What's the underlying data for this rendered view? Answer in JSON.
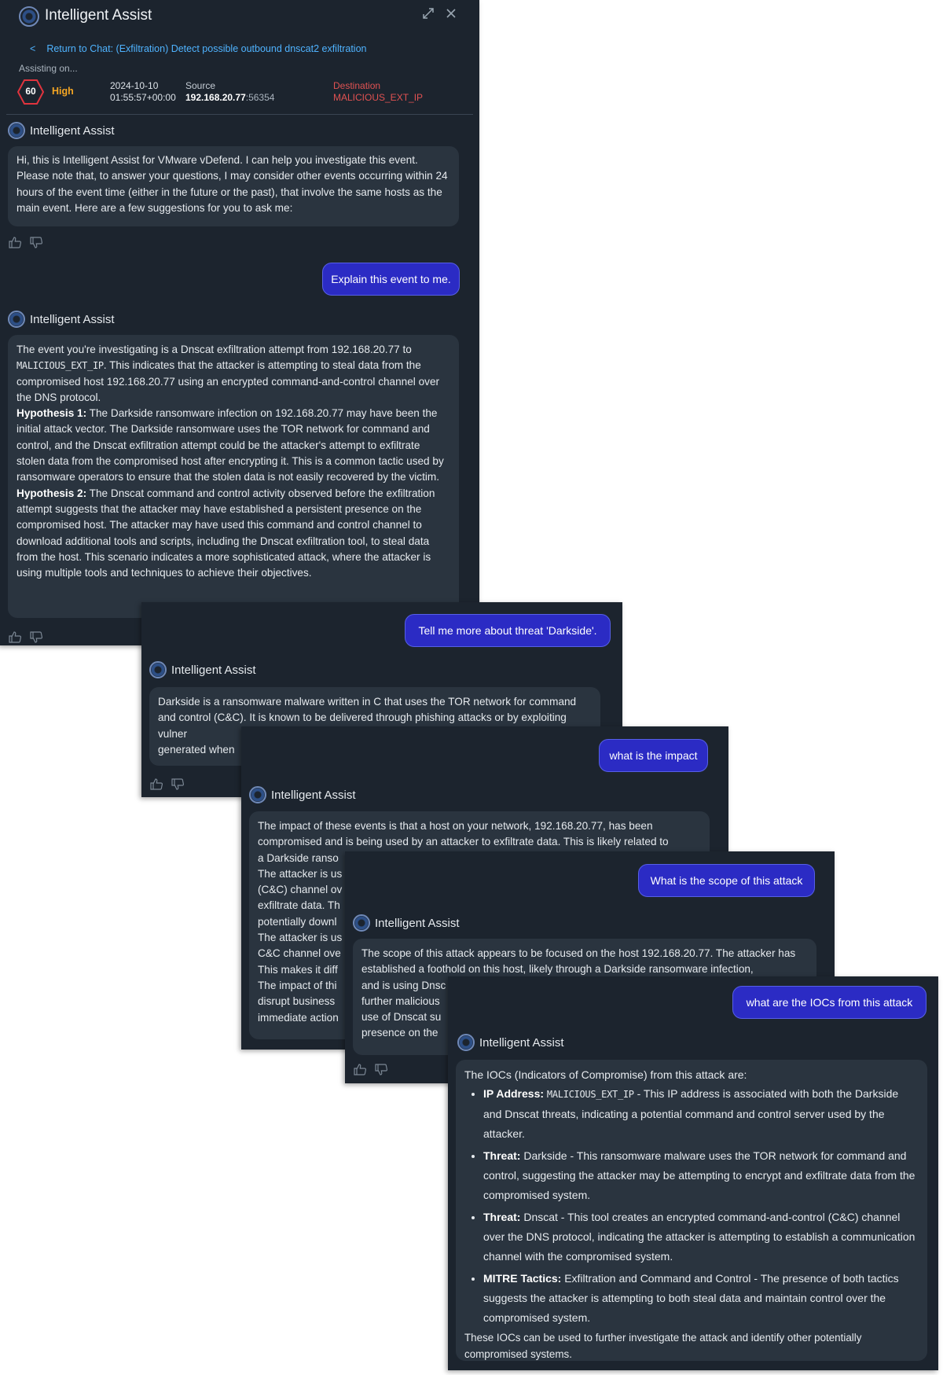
{
  "header": {
    "title": "Intelligent Assist",
    "back_link": "Return to Chat: (Exfiltration) Detect possible outbound dnscat2 exfiltration",
    "assisting_label": "Assisting on...",
    "score": "60",
    "severity": "High",
    "date": "2024-10-10",
    "time": "01:55:57+00:00",
    "source_label": "Source",
    "source_ip": "192.168.20.77",
    "source_port": ":56354",
    "destination_label": "Destination",
    "destination_value": "MALICIOUS_EXT_IP"
  },
  "assistant_name": "Intelligent Assist",
  "messages": {
    "intro": "Hi, this is Intelligent Assist for VMware vDefend. I can help you investigate this event. Please note that, to answer your questions, I may consider other events occurring within 24 hours of the event time (either in the future or the past), that involve the same hosts as the main event. Here are a few suggestions for you to ask me:",
    "q1": "Explain this event to me.",
    "a1_p1a": "The event you're investigating is a Dnscat exfiltration attempt from 192.168.20.77 to",
    "a1_p1_ip": "MALICIOUS_EXT_IP",
    "a1_p1b": ". This indicates that the attacker is attempting to steal data from the compromised host 192.168.20.77 using an encrypted command-and-control channel over the DNS protocol.",
    "a1_h1_label": "Hypothesis 1:",
    "a1_h1": " The Darkside ransomware infection on 192.168.20.77 may have been the initial attack vector. The Darkside ransomware uses the TOR network for command and control, and the Dnscat exfiltration attempt could be the attacker's attempt to exfiltrate stolen data from the compromised host after encrypting it. This is a common tactic used by ransomware operators to ensure that the stolen data is not easily recovered by the victim.",
    "a1_h2_label": "Hypothesis 2:",
    "a1_h2": " The Dnscat command and control activity observed before the exfiltration attempt suggests that the attacker may have established a persistent presence on the compromised host. The attacker may have used this command and control channel to download additional tools and scripts, including the Dnscat exfiltration tool, to steal data from the host. This scenario indicates a more sophisticated attack, where the attacker is using multiple tools and techniques to achieve their objectives.",
    "q2": "Tell me more about threat 'Darkside'.",
    "a2": "Darkside is a ransomware malware written in C that uses the TOR network for command and control (C&C). It is known to be delivered through phishing attacks or by exploiting vulner",
    "a2_tail": "generated when",
    "q3": "what is the impact",
    "a3_line1": "The impact of these events is that a host on your network, 192.168.20.77, has been compromised and is being used by an attacker to exfiltrate data. This is likely related to",
    "a3_fragments": [
      "a Darkside ranso",
      "The attacker is us",
      "(C&C) channel ov",
      "exfiltrate data. Th",
      "potentially downl",
      "The attacker is us",
      "C&C channel ove",
      "This makes it diff",
      "The impact of thi",
      "disrupt business",
      "immediate action"
    ],
    "q4": "What is the scope of this attack",
    "a4_line1": "The scope of this attack appears to be focused on the host 192.168.20.77. The attacker has established a foothold on this host, likely through a Darkside ransomware infection,",
    "a4_fragments": [
      "and is using Dnsc",
      "further malicious",
      "use of Dnscat su",
      "presence on the"
    ],
    "q5": "what are the IOCs from this attack",
    "a5_intro": "The IOCs (Indicators of Compromise) from this attack are:",
    "iocs": [
      {
        "label": "IP Address:",
        "code": "MALICIOUS_EXT_IP",
        "text": " - This IP address is associated with both the Darkside and Dnscat threats, indicating a potential command and control server used by the attacker."
      },
      {
        "label": "Threat:",
        "code": "",
        "text": " Darkside - This ransomware malware uses the TOR network for command and control, suggesting the attacker may be attempting to encrypt and exfiltrate data from the compromised system."
      },
      {
        "label": "Threat:",
        "code": "",
        "text": " Dnscat - This tool creates an encrypted command-and-control (C&C) channel over the DNS protocol, indicating the attacker is attempting to establish a communication channel with the compromised system."
      },
      {
        "label": "MITRE Tactics:",
        "code": "",
        "text": " Exfiltration and Command and Control - The presence of both tactics suggests the attacker is attempting to both steal data and maintain control over the compromised system."
      }
    ],
    "a5_outro": "These IOCs can be used to further investigate the attack and identify other potentially compromised systems."
  },
  "icons": {
    "expand": "expand-icon",
    "close": "close-icon",
    "back": "chevron-left-icon",
    "thumbs_up": "thumbs-up-icon",
    "thumbs_down": "thumbs-down-icon"
  },
  "colors": {
    "panel_bg": "#1c242e",
    "ai_bubble": "#2a343f",
    "user_bubble": "#2b2bc4",
    "link": "#4fb3ff",
    "high": "#f5a623",
    "destination": "#e05252"
  }
}
